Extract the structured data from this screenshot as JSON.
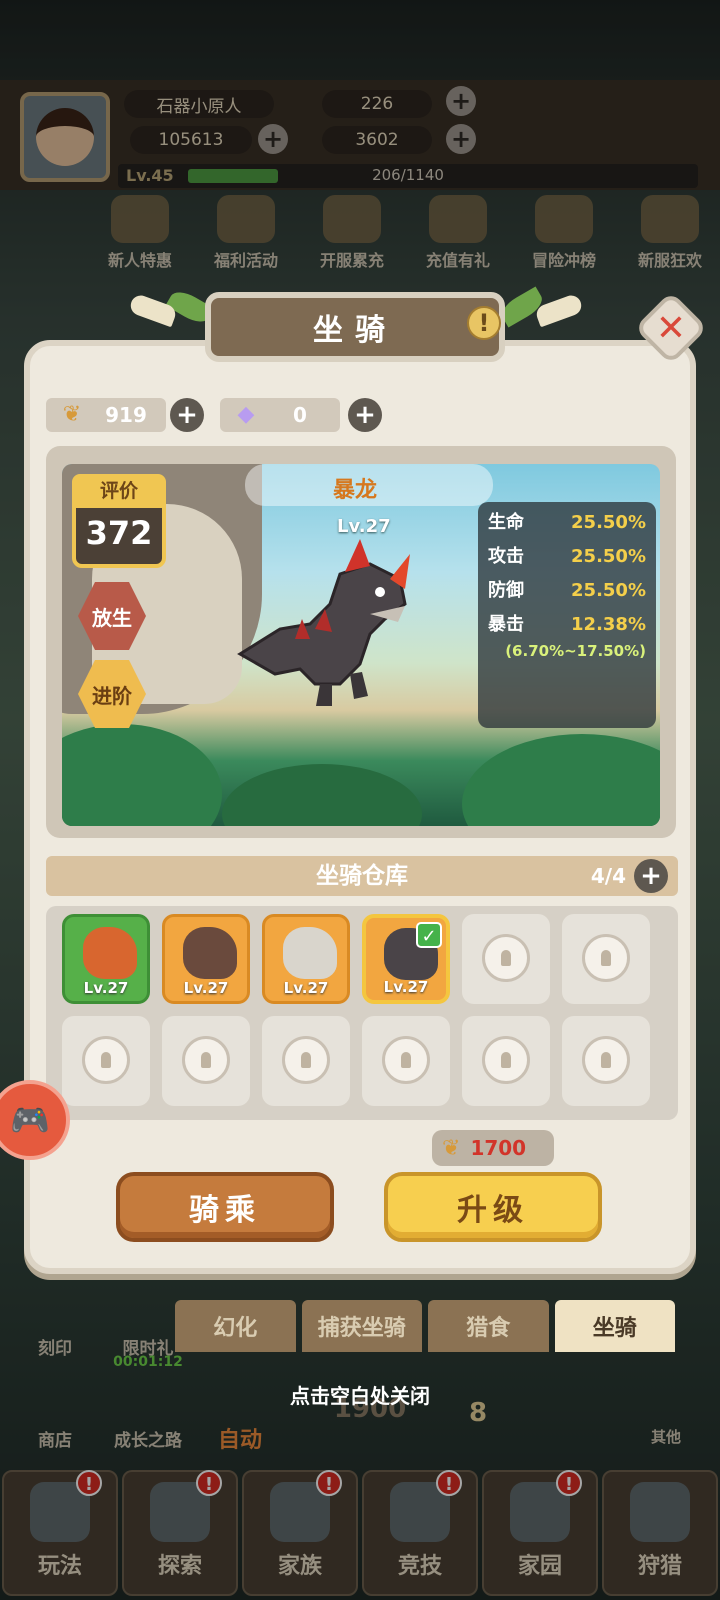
{
  "player": {
    "name": "石器小原人",
    "tickets": "226",
    "gold": "105613",
    "shells": "3602",
    "level": "Lv.45",
    "exp": "206/1140",
    "exp_fraction": 0.18
  },
  "events": [
    "新人特惠",
    "福利活动",
    "开服累充",
    "充值有礼",
    "冒险冲榜",
    "新服狂欢"
  ],
  "dialog": {
    "title": "坐骑",
    "currency": {
      "grain": "919",
      "crystal": "0"
    },
    "mount": {
      "name": "暴龙",
      "level": "Lv.27",
      "score_label": "评价",
      "score": "372",
      "release_label": "放生",
      "advance_label": "进阶",
      "stats": [
        {
          "key": "生命",
          "value": "25.50%"
        },
        {
          "key": "攻击",
          "value": "25.50%"
        },
        {
          "key": "防御",
          "value": "25.50%"
        },
        {
          "key": "暴击",
          "value": "12.38%"
        }
      ],
      "crit_range": "(6.70%~17.50%)"
    },
    "storage": {
      "title": "坐骑仓库",
      "count": "4/4",
      "slots": [
        {
          "level": "Lv.27",
          "color": "green"
        },
        {
          "level": "Lv.27",
          "color": "orange"
        },
        {
          "level": "Lv.27",
          "color": "orange"
        },
        {
          "level": "Lv.27",
          "color": "orange",
          "selected": true
        }
      ]
    },
    "upgrade_cost": "1700",
    "ride_label": "骑乘",
    "upgrade_label": "升级"
  },
  "bottom_tabs": [
    "幻化",
    "捕获坐骑",
    "猎食",
    "坐骑"
  ],
  "close_hint": "点击空白处关闭",
  "background_labels": {
    "engrave": "刻印",
    "limited": "限时礼",
    "timer": "00:01:12",
    "shop": "商店",
    "growth": "成长之路",
    "auto": "自动",
    "power": "1900",
    "other": "其他",
    "stage": "8"
  },
  "bottom_nav": [
    "玩法",
    "探索",
    "家族",
    "竞技",
    "家园",
    "狩猎"
  ],
  "colors": {
    "accent_gold": "#f0c652",
    "stat_value": "#f4cf4a",
    "cost_red": "#d2342a"
  }
}
